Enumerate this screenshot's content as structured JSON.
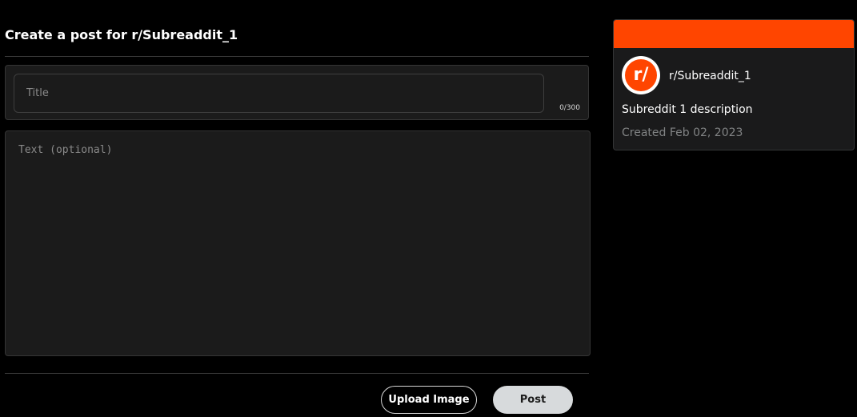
{
  "header": {
    "title": "Create a post for r/Subreaddit_1"
  },
  "form": {
    "title_placeholder": "Title",
    "title_value": "",
    "title_char_count": "0/300",
    "text_placeholder": "Text (optional)",
    "text_value": ""
  },
  "actions": {
    "upload_label": "Upload Image",
    "post_label": "Post"
  },
  "community": {
    "avatar_text": "r/",
    "name": "r/Subreaddit_1",
    "description": "Subreddit 1 description",
    "created": "Created Feb 02, 2023",
    "banner_color": "#ff4500",
    "avatar_icon": "subreddit-logo-icon"
  },
  "colors": {
    "accent": "#ff4500",
    "background": "#000000",
    "panel": "#1b1b1b",
    "post_button": "#d7dadc"
  }
}
